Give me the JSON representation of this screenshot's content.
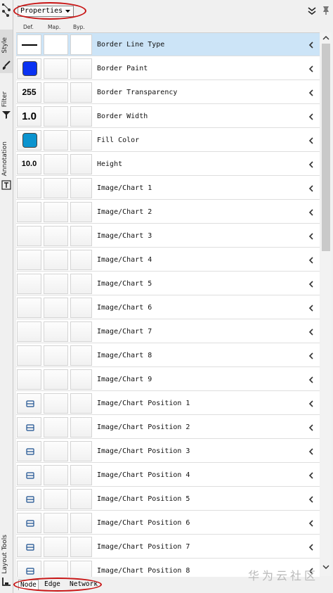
{
  "header": {
    "dropdown_label": "Properties"
  },
  "columns": {
    "def": "Def.",
    "map": "Map.",
    "byp": "Byp."
  },
  "left_tabs": {
    "style": "Style",
    "filter": "Filter",
    "annotation": "Annotation",
    "layout_tools": "Layout Tools"
  },
  "rows": [
    {
      "label": "Border Line Type",
      "def_kind": "line",
      "selected": true
    },
    {
      "label": "Border Paint",
      "def_kind": "swatch",
      "color": "#0a32f2"
    },
    {
      "label": "Border Transparency",
      "def_kind": "text",
      "def_value": "255"
    },
    {
      "label": "Border Width",
      "def_kind": "text",
      "def_value": "1.0"
    },
    {
      "label": "Fill Color",
      "def_kind": "swatch",
      "color": "#0b94cf"
    },
    {
      "label": "Height",
      "def_kind": "text",
      "def_value": "10.0"
    },
    {
      "label": "Image/Chart 1",
      "def_kind": "empty"
    },
    {
      "label": "Image/Chart 2",
      "def_kind": "empty"
    },
    {
      "label": "Image/Chart 3",
      "def_kind": "empty"
    },
    {
      "label": "Image/Chart 4",
      "def_kind": "empty"
    },
    {
      "label": "Image/Chart 5",
      "def_kind": "empty"
    },
    {
      "label": "Image/Chart 6",
      "def_kind": "empty"
    },
    {
      "label": "Image/Chart 7",
      "def_kind": "empty"
    },
    {
      "label": "Image/Chart 8",
      "def_kind": "empty"
    },
    {
      "label": "Image/Chart 9",
      "def_kind": "empty"
    },
    {
      "label": "Image/Chart Position 1",
      "def_kind": "position-icon"
    },
    {
      "label": "Image/Chart Position 2",
      "def_kind": "position-icon"
    },
    {
      "label": "Image/Chart Position 3",
      "def_kind": "position-icon"
    },
    {
      "label": "Image/Chart Position 4",
      "def_kind": "position-icon"
    },
    {
      "label": "Image/Chart Position 5",
      "def_kind": "position-icon"
    },
    {
      "label": "Image/Chart Position 6",
      "def_kind": "position-icon"
    },
    {
      "label": "Image/Chart Position 7",
      "def_kind": "position-icon"
    },
    {
      "label": "Image/Chart Position 8",
      "def_kind": "position-icon"
    }
  ],
  "bottom_tabs": [
    "Node",
    "Edge",
    "Network"
  ],
  "watermark": "华为云社区",
  "colors": {
    "selected_row": "#cce4f7",
    "annotation_oval": "#c81414"
  }
}
